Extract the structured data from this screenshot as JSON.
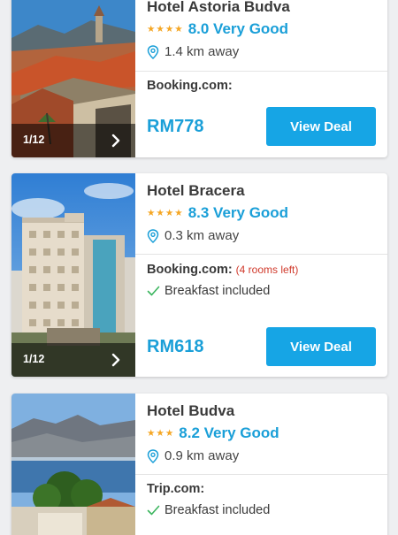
{
  "colors": {
    "accent": "#1a9fd8",
    "button": "#16a5e5",
    "star": "#f5a623",
    "alert": "#d0392b",
    "check": "#3bb55e",
    "background": "#eeeff1"
  },
  "hotels": [
    {
      "name": "Hotel Astoria Budva",
      "stars": 4,
      "rating": "8.0 Very Good",
      "distance": "1.4 km away",
      "photo_counter": "1/12",
      "provider": "Booking.com:",
      "rooms_left": "",
      "perk": "",
      "price": "RM778",
      "button_label": "View Deal"
    },
    {
      "name": "Hotel Bracera",
      "stars": 4,
      "rating": "8.3 Very Good",
      "distance": "0.3 km away",
      "photo_counter": "1/12",
      "provider": "Booking.com:",
      "rooms_left": "(4 rooms left)",
      "perk": "Breakfast included",
      "price": "RM618",
      "button_label": "View Deal"
    },
    {
      "name": "Hotel Budva",
      "stars": 3,
      "rating": "8.2 Very Good",
      "distance": "0.9 km away",
      "photo_counter": "",
      "provider": "Trip.com:",
      "rooms_left": "",
      "perk": "Breakfast included",
      "price": "",
      "button_label": ""
    }
  ],
  "icons": {
    "location": "map-pin-icon",
    "check": "check-icon",
    "next": "chevron-right-icon",
    "star": "star-icon"
  }
}
